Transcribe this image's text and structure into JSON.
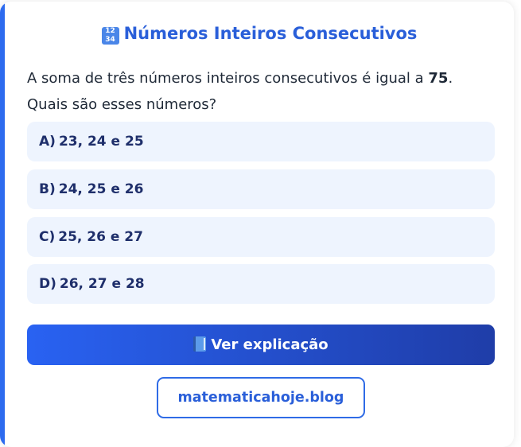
{
  "card": {
    "title_icon": "numbers-1234-icon",
    "title_icon_text_top": "12",
    "title_icon_text_bottom": "34",
    "title": "Números Inteiros Consecutivos",
    "question": {
      "text_before": "A soma de três números inteiros consecutivos é igual a ",
      "highlight": "75",
      "text_after": ". Quais são esses números?"
    },
    "options": [
      {
        "letter": "A)",
        "text": "23, 24 e 25"
      },
      {
        "letter": "B)",
        "text": "24, 25 e 26"
      },
      {
        "letter": "C)",
        "text": "25, 26 e 27"
      },
      {
        "letter": "D)",
        "text": "26, 27 e 28"
      }
    ],
    "explain_button": {
      "icon": "book-icon",
      "label": "Ver explicação"
    },
    "site_link": "matematicahoje.blog"
  },
  "colors": {
    "accent": "#2d6bef",
    "title": "#2a5fd9",
    "option_bg": "#eef4fe",
    "option_text": "#1f2f6b",
    "button_gradient_start": "#2962f2",
    "button_gradient_end": "#1f3da8"
  }
}
